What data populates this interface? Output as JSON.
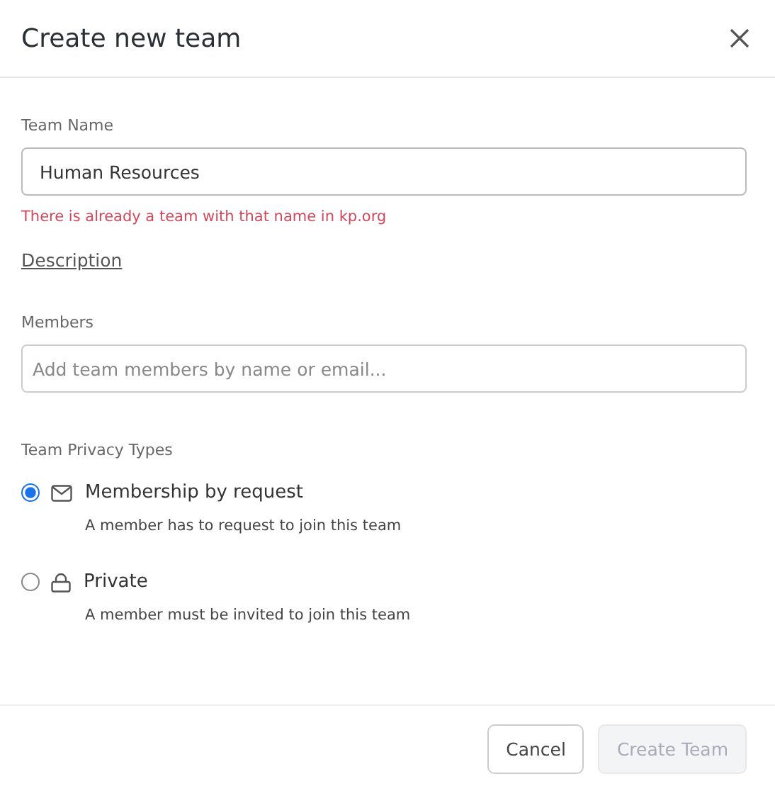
{
  "dialog": {
    "title": "Create new team"
  },
  "team_name": {
    "label": "Team Name",
    "value": "Human Resources",
    "error": "There is already a team with that name in kp.org"
  },
  "description_link": "Description",
  "members": {
    "label": "Members",
    "placeholder": "Add team members by name or email..."
  },
  "privacy": {
    "label": "Team Privacy Types",
    "options": [
      {
        "kind": "mail",
        "title": "Membership by request",
        "description": "A member has to request to join this team",
        "selected": true
      },
      {
        "kind": "lock",
        "title": "Private",
        "description": "A member must be invited to join this team",
        "selected": false
      }
    ]
  },
  "buttons": [
    {
      "label": "Cancel",
      "disabled": false
    },
    {
      "label": "Create Team",
      "disabled": true
    }
  ]
}
